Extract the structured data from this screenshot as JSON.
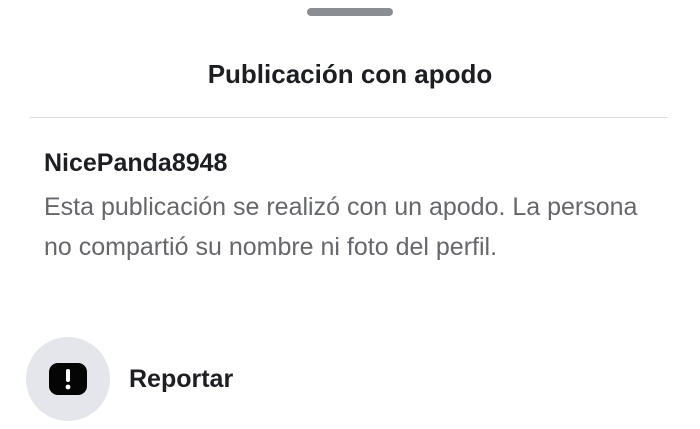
{
  "sheet": {
    "title": "Publicación con apodo"
  },
  "post": {
    "nickname": "NicePanda8948",
    "description": "Esta publicación se realizó con un apodo. La persona no compartió su nombre ni foto del perfil."
  },
  "actions": {
    "report_label": "Reportar",
    "report_icon": "alert-square-icon"
  }
}
